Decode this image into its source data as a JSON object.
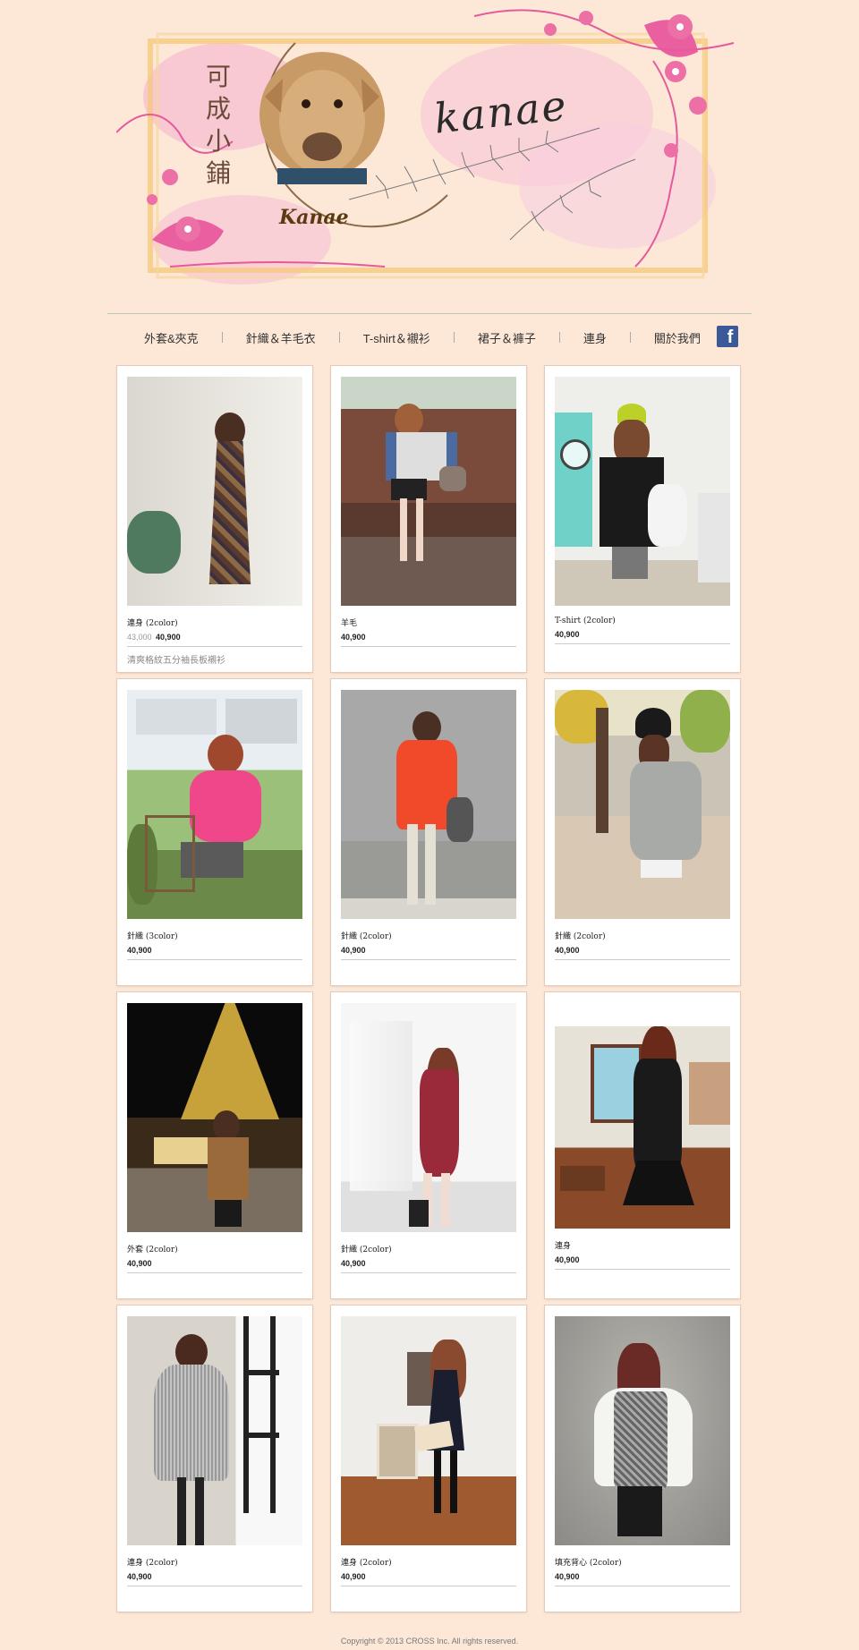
{
  "banner": {
    "brand": "kanae",
    "shop_name_chars": [
      "可",
      "成",
      "小",
      "鋪"
    ],
    "logo_word": "Kanae"
  },
  "nav": {
    "items": [
      {
        "label": "外套&夾克"
      },
      {
        "label": "針織＆羊毛衣"
      },
      {
        "label": "T-shirt＆襯衫"
      },
      {
        "label": "裙子＆褲子"
      },
      {
        "label": "連身"
      },
      {
        "label": "關於我們"
      }
    ],
    "social_icon": "facebook-icon",
    "social_glyph": "f"
  },
  "products": [
    {
      "title": "連身 (2color)",
      "old_price": "43,000",
      "price": "40,900",
      "desc": "清爽格紋五分袖長板襯衫",
      "scene": "plaid-dress"
    },
    {
      "title": "羊毛",
      "old_price": "",
      "price": "40,900",
      "desc": "",
      "scene": "bench-sweater"
    },
    {
      "title": "T-shirt (2color)",
      "old_price": "",
      "price": "40,900",
      "desc": "",
      "scene": "laundry-tshirt"
    },
    {
      "title": "針織 (3color)",
      "old_price": "",
      "price": "40,900",
      "desc": "",
      "scene": "pink-knit"
    },
    {
      "title": "針織 (2color)",
      "old_price": "",
      "price": "40,900",
      "desc": "",
      "scene": "orange-knit"
    },
    {
      "title": "針織 (2color)",
      "old_price": "",
      "price": "40,900",
      "desc": "",
      "scene": "grey-knit-street"
    },
    {
      "title": "外套 (2color)",
      "old_price": "",
      "price": "40,900",
      "desc": "",
      "scene": "eiffel-night"
    },
    {
      "title": "針織 (2color)",
      "old_price": "",
      "price": "40,900",
      "desc": "",
      "scene": "red-knit-dress"
    },
    {
      "title": "連身",
      "old_price": "",
      "price": "40,900",
      "desc": "",
      "scene": "black-dress-dresser"
    },
    {
      "title": "連身 (2color)",
      "old_price": "",
      "price": "40,900",
      "desc": "",
      "scene": "grey-dress-window"
    },
    {
      "title": "連身 (2color)",
      "old_price": "",
      "price": "40,900",
      "desc": "",
      "scene": "navy-dress-room"
    },
    {
      "title": "填充背心 (2color)",
      "old_price": "",
      "price": "40,900",
      "desc": "",
      "scene": "padded-vest"
    }
  ],
  "footer": {
    "text": "Copyright © 2013 CROSS Inc. All rights reserved."
  },
  "colors": {
    "background": "#fde8d8",
    "accent_pink": "#ec6fa6",
    "facebook": "#3b5998"
  }
}
